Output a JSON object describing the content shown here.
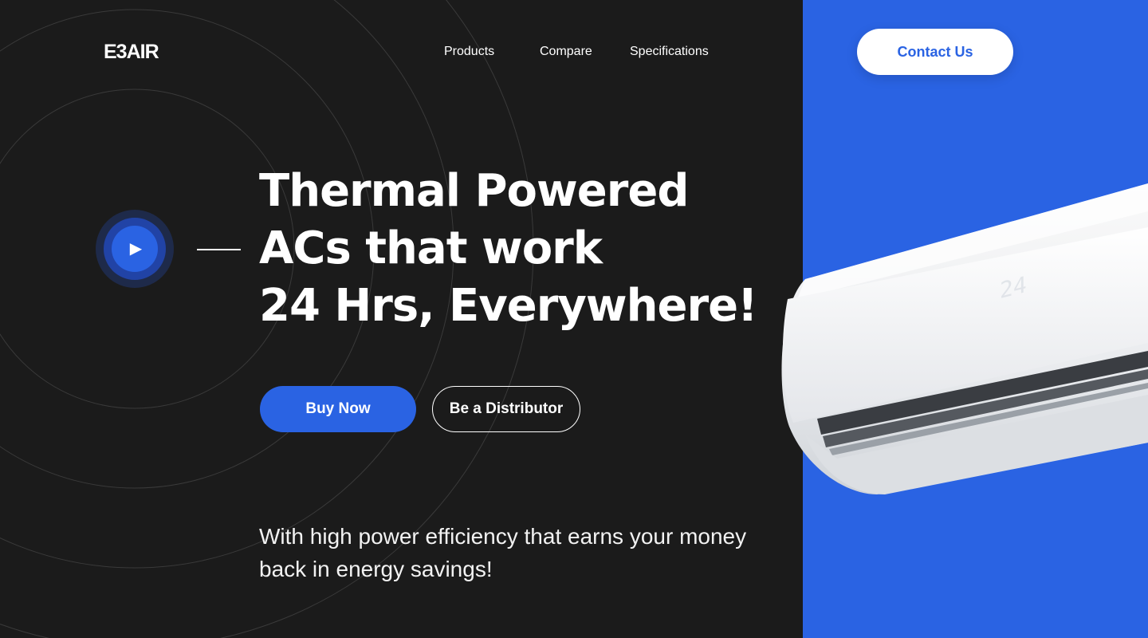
{
  "brand": {
    "logo_text": "E3AIR"
  },
  "nav": {
    "items": [
      {
        "label": "Products"
      },
      {
        "label": "Compare"
      },
      {
        "label": "Specifications"
      }
    ],
    "contact_label": "Contact Us"
  },
  "hero": {
    "headline_lines": [
      "Thermal Powered",
      "ACs that work",
      "24 Hrs, Everywhere!"
    ],
    "primary_cta": "Buy Now",
    "secondary_cta": "Be a Distributor",
    "subtext": "With high power efficiency that earns your money back in energy savings!"
  },
  "product": {
    "display_text": "24"
  },
  "colors": {
    "background": "#1b1b1b",
    "accent": "#2a63e3",
    "text": "#ffffff"
  },
  "icons": {
    "play": "play-icon"
  }
}
